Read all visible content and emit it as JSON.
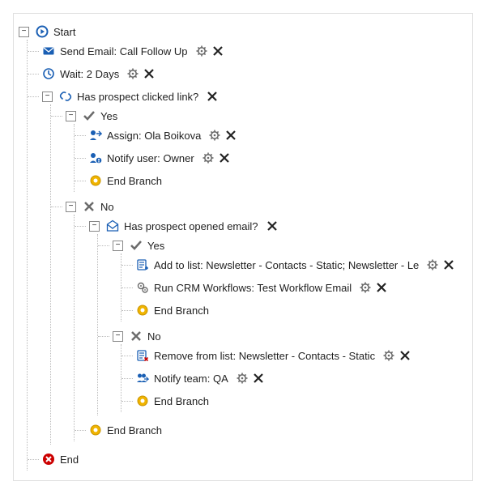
{
  "workflow": {
    "start": {
      "label": "Start"
    },
    "sendEmail": {
      "label": "Send Email: Call Follow Up"
    },
    "wait": {
      "label": "Wait: 2 Days"
    },
    "condClicked": {
      "label": "Has prospect clicked link?",
      "yes": {
        "label": "Yes",
        "assign": {
          "label": "Assign: Ola Boikova"
        },
        "notifyUser": {
          "label": "Notify user: Owner"
        },
        "endBranch": {
          "label": "End Branch"
        }
      },
      "no": {
        "label": "No",
        "condOpened": {
          "label": "Has prospect opened email?",
          "yes": {
            "label": "Yes",
            "addToList": {
              "label": "Add to list: Newsletter - Contacts - Static; Newsletter - Le"
            },
            "runCrm": {
              "label": "Run CRM Workflows: Test Workflow Email"
            },
            "endBranch": {
              "label": "End Branch"
            }
          },
          "no": {
            "label": "No",
            "removeFromList": {
              "label": "Remove from list: Newsletter - Contacts - Static"
            },
            "notifyTeam": {
              "label": "Notify team: QA"
            },
            "endBranch": {
              "label": "End Branch"
            }
          }
        },
        "endBranch": {
          "label": "End Branch"
        }
      }
    },
    "end": {
      "label": "End"
    }
  },
  "ui": {
    "expandGlyph": "−"
  }
}
